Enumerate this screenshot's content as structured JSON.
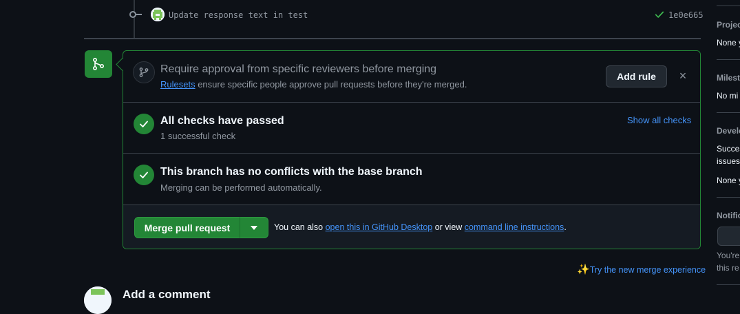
{
  "commit": {
    "message": "Update response text in test",
    "sha": "1e0e665"
  },
  "ruleset_prompt": {
    "title": "Require approval from specific reviewers before merging",
    "link_text": "Rulesets",
    "description_rest": " ensure specific people approve pull requests before they're merged.",
    "add_rule_label": "Add rule",
    "dismiss_label": "×"
  },
  "checks": {
    "title": "All checks have passed",
    "subtitle": "1 successful check",
    "show_all_label": "Show all checks"
  },
  "conflicts": {
    "title": "This branch has no conflicts with the base branch",
    "subtitle": "Merging can be performed automatically."
  },
  "merge": {
    "button_label": "Merge pull request",
    "hint_prefix": "You can also ",
    "desktop_link": "open this in GitHub Desktop",
    "hint_middle": " or view ",
    "cli_link": "command line instructions",
    "hint_suffix": "."
  },
  "try_new": {
    "sparkle": "✨",
    "label": "Try the new merge experience"
  },
  "comment": {
    "title": "Add a comment"
  },
  "sidebar": {
    "projects_heading": "Projec",
    "projects_value": "None y",
    "milestone_heading": "Milest",
    "milestone_value": "No mi",
    "development_heading": "Develo",
    "development_text_1": "Succes",
    "development_text_2": "issues.",
    "development_value": "None y",
    "notifications_heading": "Notific",
    "notifications_text_1": "You're",
    "notifications_text_2": "this re"
  },
  "colors": {
    "accent_green": "#238636",
    "link_blue": "#4493f8",
    "background": "#0d1117"
  }
}
